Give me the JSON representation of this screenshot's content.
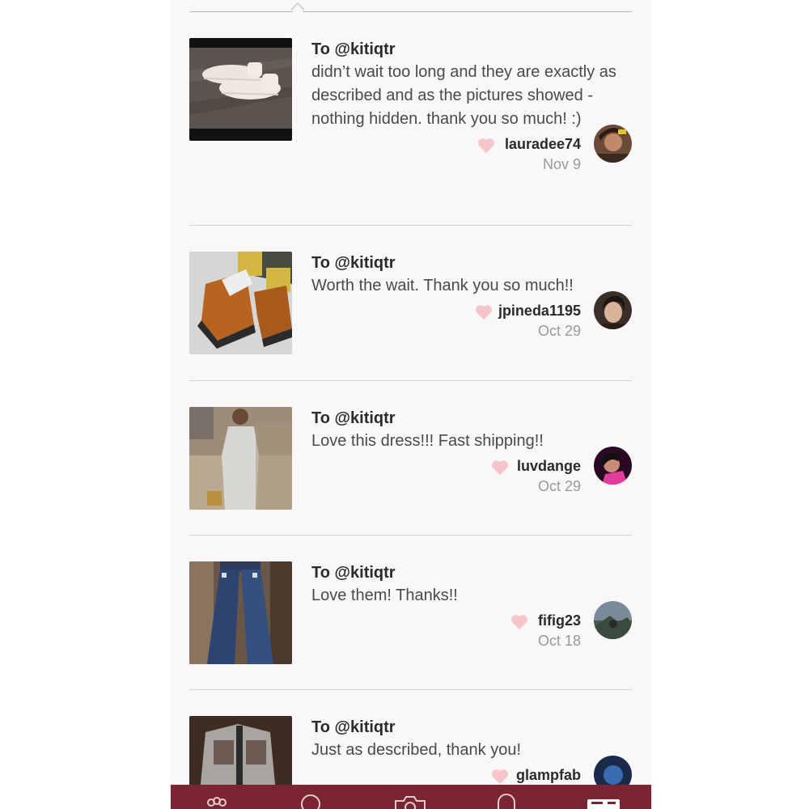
{
  "reviews": [
    {
      "to": "To @kitiqtr",
      "text": "didn’t wait too long and they are exactly as described and as the pictures showed - nothing hidden. thank you so much! :)",
      "user": "lauradee74",
      "date": "Nov 9",
      "photo_icon": "sneakers-photo",
      "avatar_icon": "user-avatar"
    },
    {
      "to": "To @kitiqtr",
      "text": "Worth the wait. Thank you so much!!",
      "user": "jpineda1195",
      "date": "Oct 29",
      "photo_icon": "boots-photo",
      "avatar_icon": "user-avatar"
    },
    {
      "to": "To @kitiqtr",
      "text": "Love this dress!!! Fast shipping!!",
      "user": "luvdange",
      "date": "Oct 29",
      "photo_icon": "dress-photo",
      "avatar_icon": "user-avatar"
    },
    {
      "to": "To @kitiqtr",
      "text": "Love them! Thanks!!",
      "user": "fifig23",
      "date": "Oct 18",
      "photo_icon": "jeans-photo",
      "avatar_icon": "user-avatar"
    },
    {
      "to": "To @kitiqtr",
      "text": "Just as described, thank you!",
      "user": "glampfab",
      "date": "",
      "photo_icon": "jacket-photo",
      "avatar_icon": "user-avatar"
    }
  ],
  "tabbar": {
    "icons": [
      "community-icon",
      "search-icon",
      "camera-icon",
      "notifications-icon",
      "closet-icon"
    ]
  },
  "colors": {
    "heart": "#f6c4cb",
    "tabbar": "#7a2531",
    "background": "#f9f7f8"
  }
}
